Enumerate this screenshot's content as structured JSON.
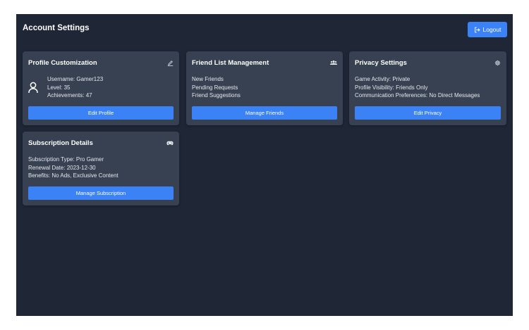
{
  "header": {
    "title": "Account Settings",
    "logout_label": "Logout"
  },
  "profile": {
    "title": "Profile Customization",
    "icon": "pencil-icon",
    "username": "Username: Gamer123",
    "level": "Level: 35",
    "achievements": "Achievements: 47",
    "button_label": "Edit Profile"
  },
  "friends": {
    "title": "Friend List Management",
    "icon": "users-icon",
    "items": [
      "New Friends",
      "Pending Requests",
      "Friend Suggestions"
    ],
    "button_label": "Manage Friends"
  },
  "privacy": {
    "title": "Privacy Settings",
    "icon": "gear-icon",
    "items": [
      "Game Activity: Private",
      "Profile Visibility: Friends Only",
      "Communication Preferences: No Direct Messages"
    ],
    "button_label": "Edit Privacy"
  },
  "subscription": {
    "title": "Subscription Details",
    "icon": "gamepad-icon",
    "items": [
      "Subscription Type: Pro Gamer",
      "Renewal Date: 2023-12-30",
      "Benefits: No Ads, Exclusive Content"
    ],
    "button_label": "Manage Subscription"
  },
  "colors": {
    "page_bg": "#1f2737",
    "card_bg": "#374151",
    "accent": "#3b82f6"
  }
}
